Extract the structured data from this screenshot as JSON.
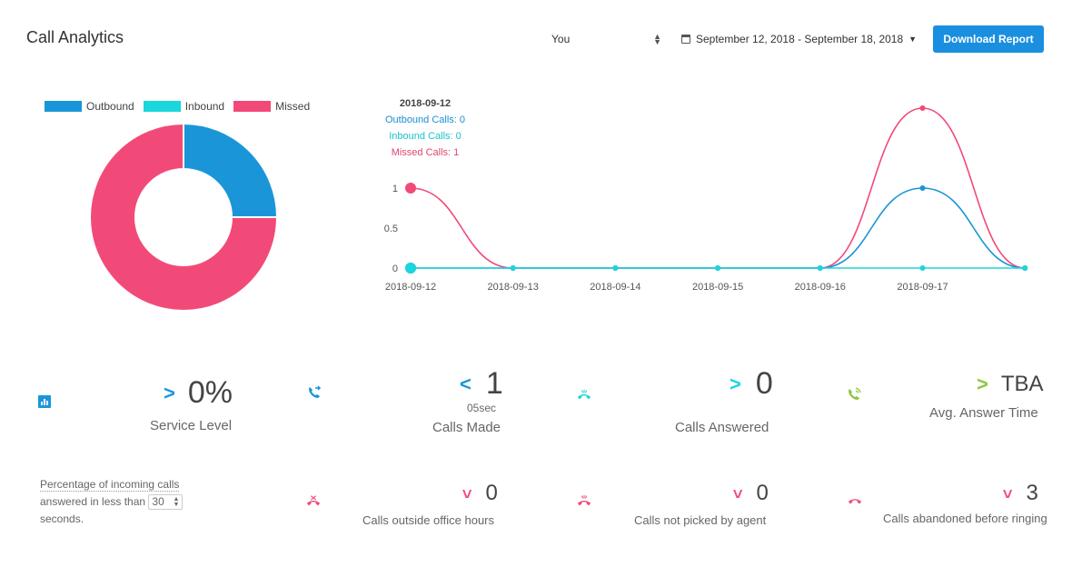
{
  "header": {
    "title": "Call Analytics",
    "user_select": "You",
    "date_range": "September 12, 2018 - September 18, 2018",
    "download_label": "Download Report"
  },
  "legend": [
    {
      "label": "Outbound",
      "color": "#1a96d8"
    },
    {
      "label": "Inbound",
      "color": "#1bd6dc"
    },
    {
      "label": "Missed",
      "color": "#f24a78"
    }
  ],
  "tooltip": {
    "date": "2018-09-12",
    "outbound": "Outbound Calls: 0",
    "inbound": "Inbound Calls: 0",
    "missed": "Missed Calls: 1"
  },
  "chart_data": [
    {
      "type": "pie",
      "title": "",
      "labels": [
        "Outbound",
        "Inbound",
        "Missed"
      ],
      "values": [
        1,
        0,
        3
      ],
      "colors": [
        "#1a96d8",
        "#1bd6dc",
        "#f24a78"
      ]
    },
    {
      "type": "line",
      "title": "",
      "x": [
        "2018-09-12",
        "2018-09-13",
        "2018-09-14",
        "2018-09-15",
        "2018-09-16",
        "2018-09-17",
        "2018-09-18"
      ],
      "x_tick_labels": [
        "2018-09-12",
        "2018-09-13",
        "2018-09-14",
        "2018-09-15",
        "2018-09-16",
        "2018-09-17"
      ],
      "y_ticks": [
        "0",
        "0.5",
        "1"
      ],
      "ylim": [
        0,
        1
      ],
      "series": [
        {
          "name": "Outbound",
          "color": "#1a96d8",
          "values": [
            0,
            0,
            0,
            0,
            0,
            1,
            0
          ]
        },
        {
          "name": "Inbound",
          "color": "#1bd6dc",
          "values": [
            0,
            0,
            0,
            0,
            0,
            0,
            0
          ]
        },
        {
          "name": "Missed",
          "color": "#f24a78",
          "values": [
            1,
            0,
            0,
            0,
            0,
            2,
            0
          ]
        }
      ]
    }
  ],
  "stats": {
    "service_level": {
      "value": "0%",
      "label": "Service Level",
      "icon": "bar-chart-icon",
      "trend": "up",
      "color": "#1a96d8"
    },
    "calls_made": {
      "value": "1",
      "sub": "05sec",
      "label": "Calls Made",
      "icon": "outgoing-call-icon",
      "trend": "down",
      "color": "#1a96d8"
    },
    "calls_answered": {
      "value": "0",
      "label": "Calls Answered",
      "icon": "incoming-call-icon",
      "trend": "up",
      "color": "#1bd6dc"
    },
    "avg_answer": {
      "value": "TBA",
      "label": "Avg. Answer Time",
      "icon": "phone-ringing-icon",
      "trend": "up",
      "color": "#8cc63f"
    },
    "outside_hours": {
      "value": "0",
      "label": "Calls outside office hours",
      "icon": "call-blocked-icon",
      "color": "#f24a78"
    },
    "not_picked": {
      "value": "0",
      "label": "Calls not picked by agent",
      "icon": "missed-call-icon",
      "color": "#f24a78"
    },
    "abandoned": {
      "value": "3",
      "label": "Calls abandoned before ringing",
      "icon": "hang-up-icon",
      "color": "#f24a78"
    }
  },
  "service_desc": {
    "line1": "Percentage of incoming calls",
    "line2_pre": "answered in less than",
    "threshold": "30",
    "line3": "seconds."
  }
}
